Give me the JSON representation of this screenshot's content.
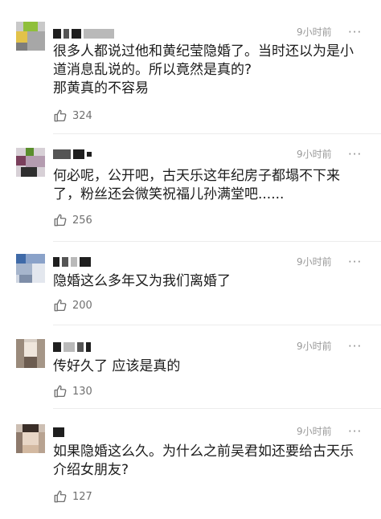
{
  "comments": [
    {
      "time": "9小时前",
      "more": "···",
      "text": "很多人都说过他和黄纪莹隐婚了。当时还以为是小\n道消息乱说的。所以竟然是真的?\n那黄真的不容易",
      "likes": "324"
    },
    {
      "time": "9小时前",
      "more": "···",
      "text": "何必呢，公开吧，古天乐这年纪房子都塌不下来\n了，粉丝还会微笑祝福儿孙满堂吧......",
      "likes": "256"
    },
    {
      "time": "9小时前",
      "more": "···",
      "text": "隐婚这么多年又为我们离婚了",
      "likes": "200"
    },
    {
      "time": "9小时前",
      "more": "···",
      "text": "传好久了 应该是真的",
      "likes": "130"
    },
    {
      "time": "9小时前",
      "more": "···",
      "text": "如果隐婚这么久。为什么之前吴君如还要给古天乐\n介绍女朋友?",
      "likes": "127"
    }
  ],
  "icons": {
    "like": "thumbs-up-icon",
    "more": "more-dots-icon"
  },
  "colors": {
    "text": "#1b1b1b",
    "meta": "#9a9a9a",
    "like_count": "#707070"
  }
}
